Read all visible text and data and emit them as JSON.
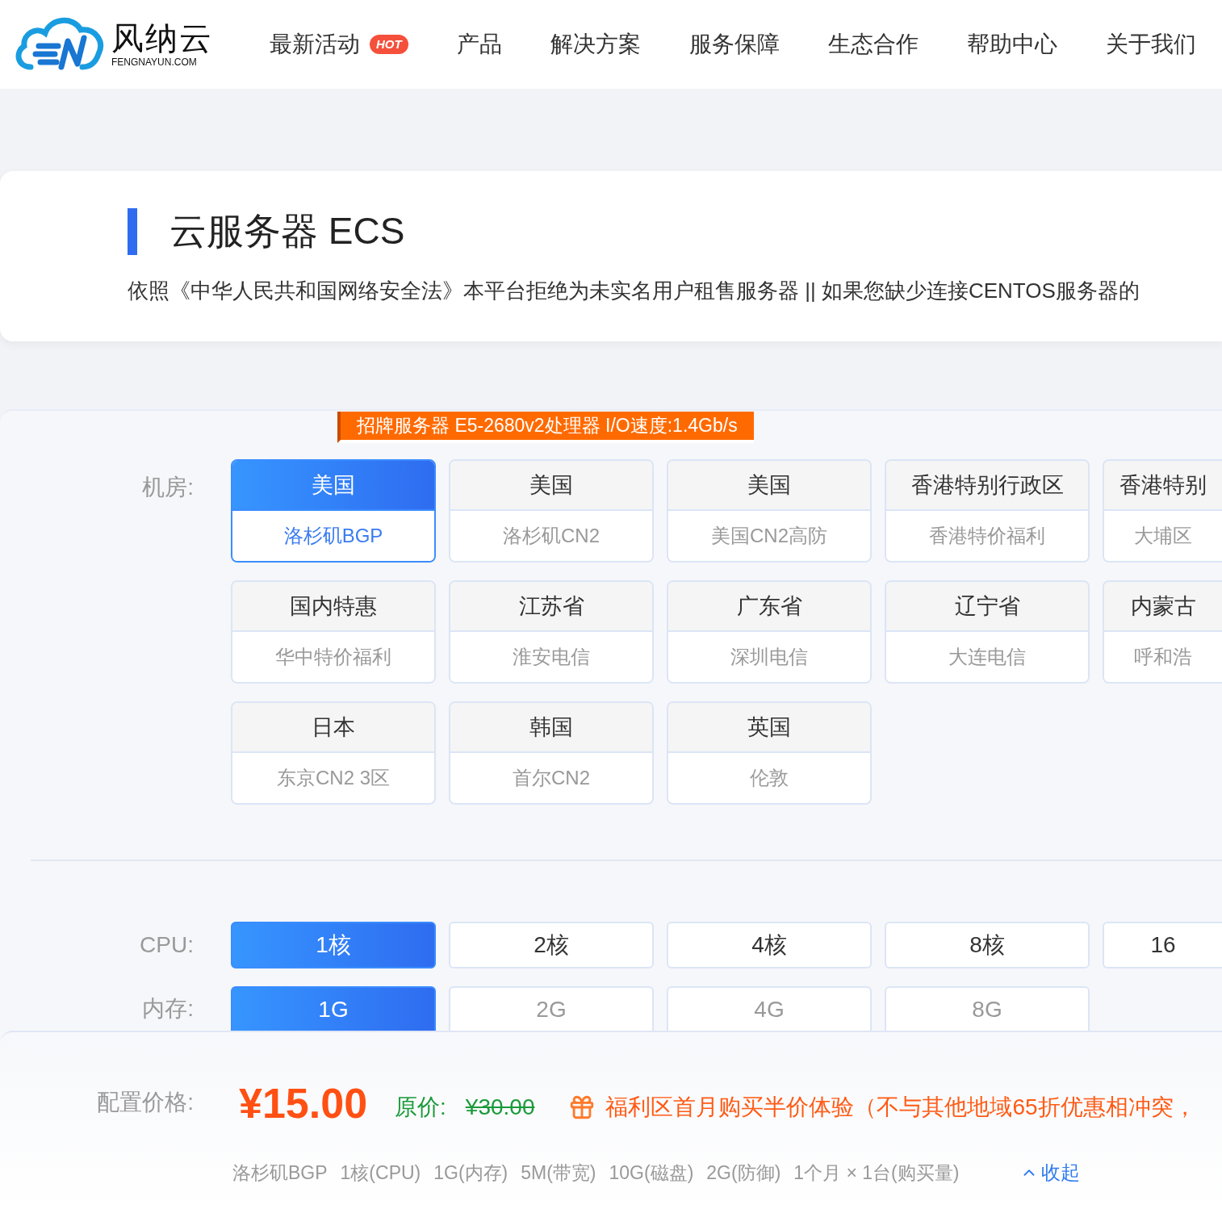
{
  "brand": {
    "name": "风纳云",
    "domain": "FENGNAYUN.COM"
  },
  "nav": [
    {
      "label": "最新活动",
      "badge": "HOT"
    },
    {
      "label": "产品"
    },
    {
      "label": "解决方案"
    },
    {
      "label": "服务保障"
    },
    {
      "label": "生态合作"
    },
    {
      "label": "帮助中心"
    },
    {
      "label": "关于我们"
    }
  ],
  "header": {
    "title": "云服务器 ECS",
    "notice": "依照《中华人民共和国网络安全法》本平台拒绝为未实名用户租售服务器 || 如果您缺少连接CENTOS服务器的"
  },
  "ribbon": "招牌服务器 E5-2680v2处理器 I/O速度:1.4Gb/s",
  "datacenter": {
    "label": "机房:",
    "options": [
      {
        "region": "美国",
        "line": "洛杉矶BGP",
        "selected": true
      },
      {
        "region": "美国",
        "line": "洛杉矶CN2",
        "selected": false
      },
      {
        "region": "美国",
        "line": "美国CN2高防",
        "selected": false
      },
      {
        "region": "香港特别行政区",
        "line": "香港特价福利",
        "selected": false
      },
      {
        "region": "香港特别",
        "line": "大埔区",
        "selected": false
      },
      {
        "region": "国内特惠",
        "line": "华中特价福利",
        "selected": false
      },
      {
        "region": "江苏省",
        "line": "淮安电信",
        "selected": false
      },
      {
        "region": "广东省",
        "line": "深圳电信",
        "selected": false
      },
      {
        "region": "辽宁省",
        "line": "大连电信",
        "selected": false
      },
      {
        "region": "内蒙古",
        "line": "呼和浩",
        "selected": false
      },
      {
        "region": "日本",
        "line": "东京CN2 3区",
        "selected": false
      },
      {
        "region": "韩国",
        "line": "首尔CN2",
        "selected": false
      },
      {
        "region": "英国",
        "line": "伦敦",
        "selected": false
      }
    ]
  },
  "cpu": {
    "label": "CPU:",
    "options": [
      {
        "label": "1核",
        "selected": true
      },
      {
        "label": "2核",
        "selected": false
      },
      {
        "label": "4核",
        "selected": false
      },
      {
        "label": "8核",
        "selected": false
      },
      {
        "label": "16",
        "selected": false
      }
    ]
  },
  "memory": {
    "label": "内存:",
    "options": [
      {
        "label": "1G",
        "selected": true
      },
      {
        "label": "2G",
        "selected": false
      },
      {
        "label": "4G",
        "selected": false
      },
      {
        "label": "8G",
        "selected": false
      }
    ]
  },
  "price": {
    "label": "配置价格:",
    "current": "¥15.00",
    "original_label": "原价:",
    "original": "¥30.00",
    "promo": "福利区首月购买半价体验（不与其他地域65折优惠相冲突，",
    "summary": [
      "洛杉矶BGP",
      "1核(CPU)",
      "1G(内存)",
      "5M(带宽)",
      "10G(磁盘)",
      "2G(防御)",
      "1个月 × 1台(购买量)"
    ],
    "collapse": "收起"
  }
}
